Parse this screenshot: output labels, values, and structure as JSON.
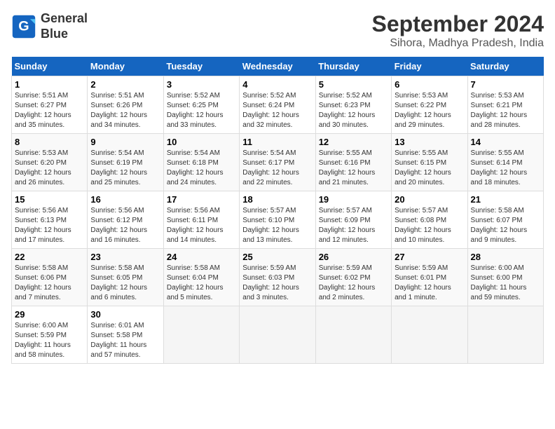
{
  "header": {
    "logo_line1": "General",
    "logo_line2": "Blue",
    "title": "September 2024",
    "subtitle": "Sihora, Madhya Pradesh, India"
  },
  "weekdays": [
    "Sunday",
    "Monday",
    "Tuesday",
    "Wednesday",
    "Thursday",
    "Friday",
    "Saturday"
  ],
  "weeks": [
    [
      {
        "day": "1",
        "info": "Sunrise: 5:51 AM\nSunset: 6:27 PM\nDaylight: 12 hours\nand 35 minutes."
      },
      {
        "day": "2",
        "info": "Sunrise: 5:51 AM\nSunset: 6:26 PM\nDaylight: 12 hours\nand 34 minutes."
      },
      {
        "day": "3",
        "info": "Sunrise: 5:52 AM\nSunset: 6:25 PM\nDaylight: 12 hours\nand 33 minutes."
      },
      {
        "day": "4",
        "info": "Sunrise: 5:52 AM\nSunset: 6:24 PM\nDaylight: 12 hours\nand 32 minutes."
      },
      {
        "day": "5",
        "info": "Sunrise: 5:52 AM\nSunset: 6:23 PM\nDaylight: 12 hours\nand 30 minutes."
      },
      {
        "day": "6",
        "info": "Sunrise: 5:53 AM\nSunset: 6:22 PM\nDaylight: 12 hours\nand 29 minutes."
      },
      {
        "day": "7",
        "info": "Sunrise: 5:53 AM\nSunset: 6:21 PM\nDaylight: 12 hours\nand 28 minutes."
      }
    ],
    [
      {
        "day": "8",
        "info": "Sunrise: 5:53 AM\nSunset: 6:20 PM\nDaylight: 12 hours\nand 26 minutes."
      },
      {
        "day": "9",
        "info": "Sunrise: 5:54 AM\nSunset: 6:19 PM\nDaylight: 12 hours\nand 25 minutes."
      },
      {
        "day": "10",
        "info": "Sunrise: 5:54 AM\nSunset: 6:18 PM\nDaylight: 12 hours\nand 24 minutes."
      },
      {
        "day": "11",
        "info": "Sunrise: 5:54 AM\nSunset: 6:17 PM\nDaylight: 12 hours\nand 22 minutes."
      },
      {
        "day": "12",
        "info": "Sunrise: 5:55 AM\nSunset: 6:16 PM\nDaylight: 12 hours\nand 21 minutes."
      },
      {
        "day": "13",
        "info": "Sunrise: 5:55 AM\nSunset: 6:15 PM\nDaylight: 12 hours\nand 20 minutes."
      },
      {
        "day": "14",
        "info": "Sunrise: 5:55 AM\nSunset: 6:14 PM\nDaylight: 12 hours\nand 18 minutes."
      }
    ],
    [
      {
        "day": "15",
        "info": "Sunrise: 5:56 AM\nSunset: 6:13 PM\nDaylight: 12 hours\nand 17 minutes."
      },
      {
        "day": "16",
        "info": "Sunrise: 5:56 AM\nSunset: 6:12 PM\nDaylight: 12 hours\nand 16 minutes."
      },
      {
        "day": "17",
        "info": "Sunrise: 5:56 AM\nSunset: 6:11 PM\nDaylight: 12 hours\nand 14 minutes."
      },
      {
        "day": "18",
        "info": "Sunrise: 5:57 AM\nSunset: 6:10 PM\nDaylight: 12 hours\nand 13 minutes."
      },
      {
        "day": "19",
        "info": "Sunrise: 5:57 AM\nSunset: 6:09 PM\nDaylight: 12 hours\nand 12 minutes."
      },
      {
        "day": "20",
        "info": "Sunrise: 5:57 AM\nSunset: 6:08 PM\nDaylight: 12 hours\nand 10 minutes."
      },
      {
        "day": "21",
        "info": "Sunrise: 5:58 AM\nSunset: 6:07 PM\nDaylight: 12 hours\nand 9 minutes."
      }
    ],
    [
      {
        "day": "22",
        "info": "Sunrise: 5:58 AM\nSunset: 6:06 PM\nDaylight: 12 hours\nand 7 minutes."
      },
      {
        "day": "23",
        "info": "Sunrise: 5:58 AM\nSunset: 6:05 PM\nDaylight: 12 hours\nand 6 minutes."
      },
      {
        "day": "24",
        "info": "Sunrise: 5:58 AM\nSunset: 6:04 PM\nDaylight: 12 hours\nand 5 minutes."
      },
      {
        "day": "25",
        "info": "Sunrise: 5:59 AM\nSunset: 6:03 PM\nDaylight: 12 hours\nand 3 minutes."
      },
      {
        "day": "26",
        "info": "Sunrise: 5:59 AM\nSunset: 6:02 PM\nDaylight: 12 hours\nand 2 minutes."
      },
      {
        "day": "27",
        "info": "Sunrise: 5:59 AM\nSunset: 6:01 PM\nDaylight: 12 hours\nand 1 minute."
      },
      {
        "day": "28",
        "info": "Sunrise: 6:00 AM\nSunset: 6:00 PM\nDaylight: 11 hours\nand 59 minutes."
      }
    ],
    [
      {
        "day": "29",
        "info": "Sunrise: 6:00 AM\nSunset: 5:59 PM\nDaylight: 11 hours\nand 58 minutes."
      },
      {
        "day": "30",
        "info": "Sunrise: 6:01 AM\nSunset: 5:58 PM\nDaylight: 11 hours\nand 57 minutes."
      },
      {
        "day": "",
        "info": ""
      },
      {
        "day": "",
        "info": ""
      },
      {
        "day": "",
        "info": ""
      },
      {
        "day": "",
        "info": ""
      },
      {
        "day": "",
        "info": ""
      }
    ]
  ]
}
